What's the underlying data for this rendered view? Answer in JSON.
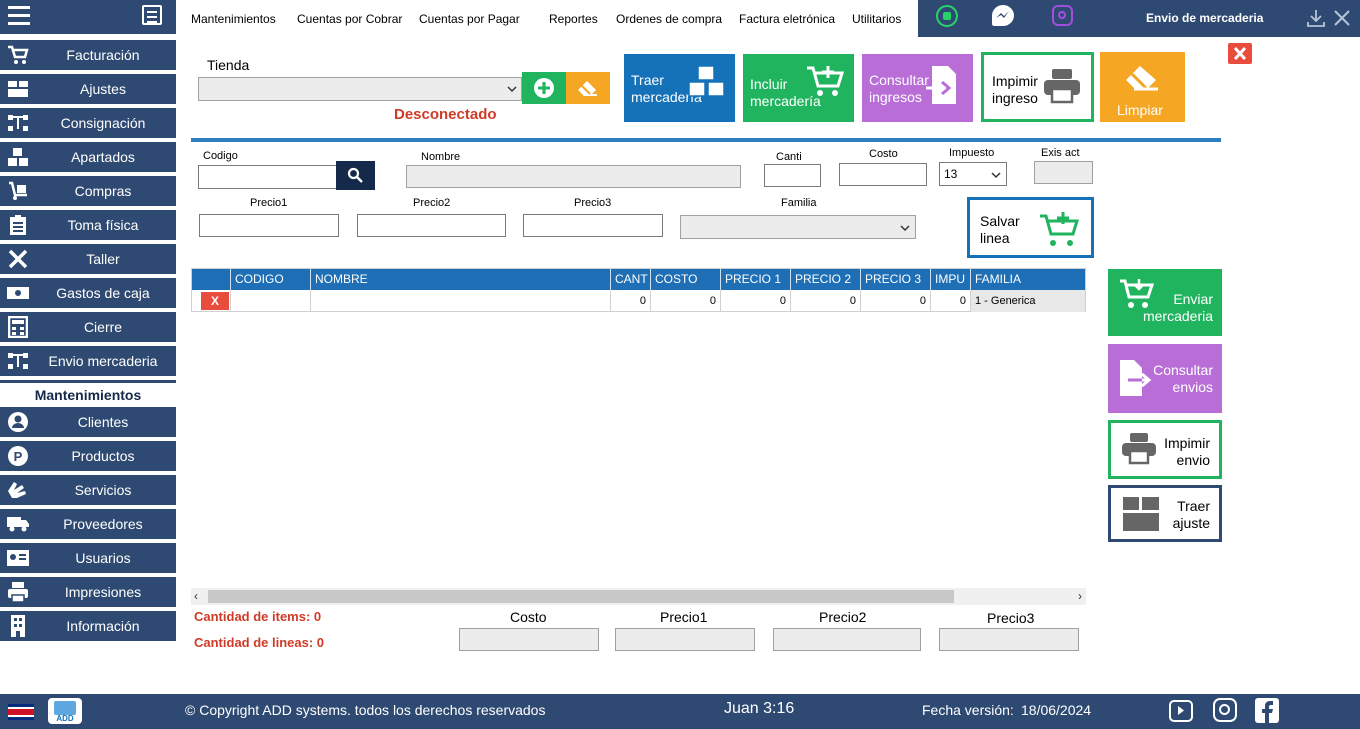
{
  "colors": {
    "sidebar": "#2f4a72",
    "accent_blue": "#1572b8",
    "green": "#20b45f",
    "purple": "#b86ed6",
    "orange": "#f5a623",
    "red": "#e74c3c",
    "error_text": "#d03b28"
  },
  "sidebar": {
    "items": [
      {
        "label": "Facturación",
        "icon": "cart-icon"
      },
      {
        "label": "Ajustes",
        "icon": "box-icon"
      },
      {
        "label": "Consignación",
        "icon": "network-icon"
      },
      {
        "label": "Apartados",
        "icon": "boxes-icon"
      },
      {
        "label": "Compras",
        "icon": "dolly-icon"
      },
      {
        "label": "Toma física",
        "icon": "clipboard-icon"
      },
      {
        "label": "Taller",
        "icon": "tools-icon"
      },
      {
        "label": "Gastos de caja",
        "icon": "money-icon"
      },
      {
        "label": "Cierre",
        "icon": "calculator-icon"
      },
      {
        "label": "Envio mercaderia",
        "icon": "network-icon"
      }
    ],
    "section_title": "Mantenimientos",
    "items2": [
      {
        "label": "Clientes",
        "icon": "user-icon"
      },
      {
        "label": "Productos",
        "icon": "product-icon"
      },
      {
        "label": "Servicios",
        "icon": "hands-icon"
      },
      {
        "label": "Proveedores",
        "icon": "truck-icon"
      },
      {
        "label": "Usuarios",
        "icon": "id-card-icon"
      },
      {
        "label": "Impresiones",
        "icon": "print-icon"
      },
      {
        "label": "Información",
        "icon": "building-icon"
      }
    ]
  },
  "topmenu": {
    "mant": "Mantenimientos",
    "cxc": "Cuentas por Cobrar",
    "cxp": "Cuentas por Pagar",
    "rep": "Reportes",
    "oc": "Ordenes de compra",
    "fe": "Factura eletrónica",
    "util": "Utilitarios"
  },
  "window_title": "Envio de mercaderia",
  "store": {
    "label": "Tienda",
    "status": "Desconectado"
  },
  "actions": {
    "traer": "Traer mercadería",
    "incluir": "Incluir mercadería",
    "consultar": "Consultar ingresos",
    "imprimir": "Impimir ingreso",
    "limpiar": "Limpiar"
  },
  "form": {
    "codigo": "Codigo",
    "nombre": "Nombre",
    "canti": "Canti",
    "costo": "Costo",
    "impuesto": "Impuesto",
    "impuesto_value": "13",
    "exis": "Exis act",
    "precio1": "Precio1",
    "precio2": "Precio2",
    "precio3": "Precio3",
    "familia": "Familia",
    "salvar": "Salvar linea"
  },
  "table": {
    "columns": [
      "CODIGO",
      "NOMBRE",
      "CANT",
      "COSTO",
      "PRECIO 1",
      "PRECIO 2",
      "PRECIO 3",
      "IMPU",
      "FAMILIA"
    ],
    "rows": [
      {
        "del": "X",
        "codigo": "",
        "nombre": "",
        "cant": "0",
        "costo": "0",
        "precio1": "0",
        "precio2": "0",
        "precio3": "0",
        "impu": "0",
        "familia": "1 - Generica"
      }
    ]
  },
  "side": {
    "enviar": "Enviar mercaderia",
    "consultar": "Consultar envios",
    "imprimir": "Impimir envio",
    "traer": "Traer ajuste"
  },
  "totals": {
    "items": "Cantidad de items: 0",
    "lineas": "Cantidad de lineas: 0",
    "costo": "Costo",
    "precio1": "Precio1",
    "precio2": "Precio2",
    "precio3": "Precio3"
  },
  "footer": {
    "copyright": "© Copyright ADD systems. todos los derechos reservados",
    "verse": "Juan 3:16",
    "version_label": "Fecha versión:",
    "version_date": "18/06/2024"
  }
}
